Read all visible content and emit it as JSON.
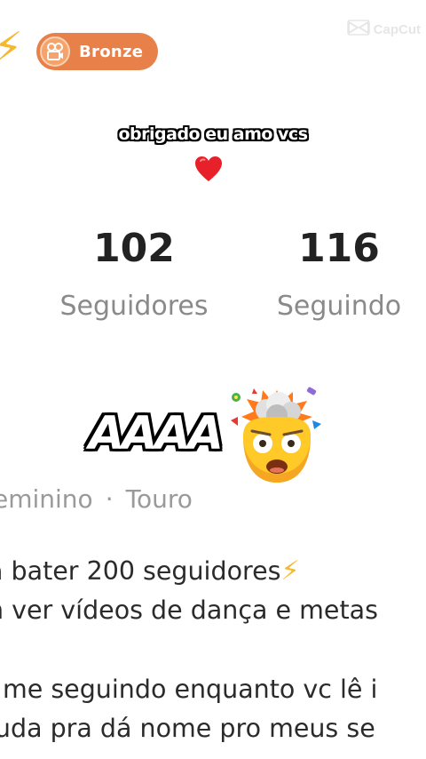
{
  "badge": {
    "label": "Bronze",
    "color": "#e8804a",
    "icon": "film-reel-icon"
  },
  "watermark": {
    "text": "CapCut",
    "icon": "capcut-logo-icon"
  },
  "caption": {
    "text": "obrigado eu amo vcs",
    "emoji": "red-heart-icon"
  },
  "stats": {
    "followers": {
      "value": "102",
      "label": "Seguidores"
    },
    "following": {
      "value": "116",
      "label": "Seguindo"
    }
  },
  "overlay": {
    "text": "AAAA",
    "emoji": "exploding-head-emoji"
  },
  "profile": {
    "gender": "eminino",
    "separator": "·",
    "sign": "Touro"
  },
  "bio": {
    "lines": [
      "a bater 200 seguidores",
      "n ver vídeos de dança e metas",
      "í me seguindo enquanto vc lê i",
      "juda pra dá nome pro meus se"
    ],
    "bolt": "⚡"
  },
  "colors": {
    "accent_bolt": "#f5b82e",
    "text_dark": "#222222",
    "text_muted": "#8a8a8a",
    "heart": "#e8202a"
  }
}
